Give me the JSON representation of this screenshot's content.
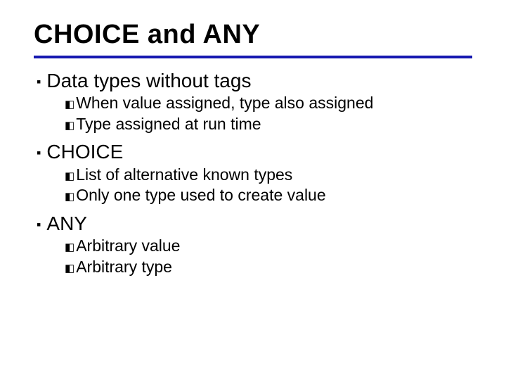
{
  "title": "CHOICE and ANY",
  "bullets": [
    {
      "text": "Data types without tags",
      "sub": [
        "When value assigned, type also assigned",
        "Type assigned at run time"
      ]
    },
    {
      "text": "CHOICE",
      "sub": [
        "List of alternative known types",
        "Only one type used to create value"
      ]
    },
    {
      "text": "ANY",
      "sub": [
        "Arbitrary value",
        "Arbitrary type"
      ]
    }
  ],
  "glyphs": {
    "lvl1": "❚",
    "lvl2": "⚫"
  }
}
